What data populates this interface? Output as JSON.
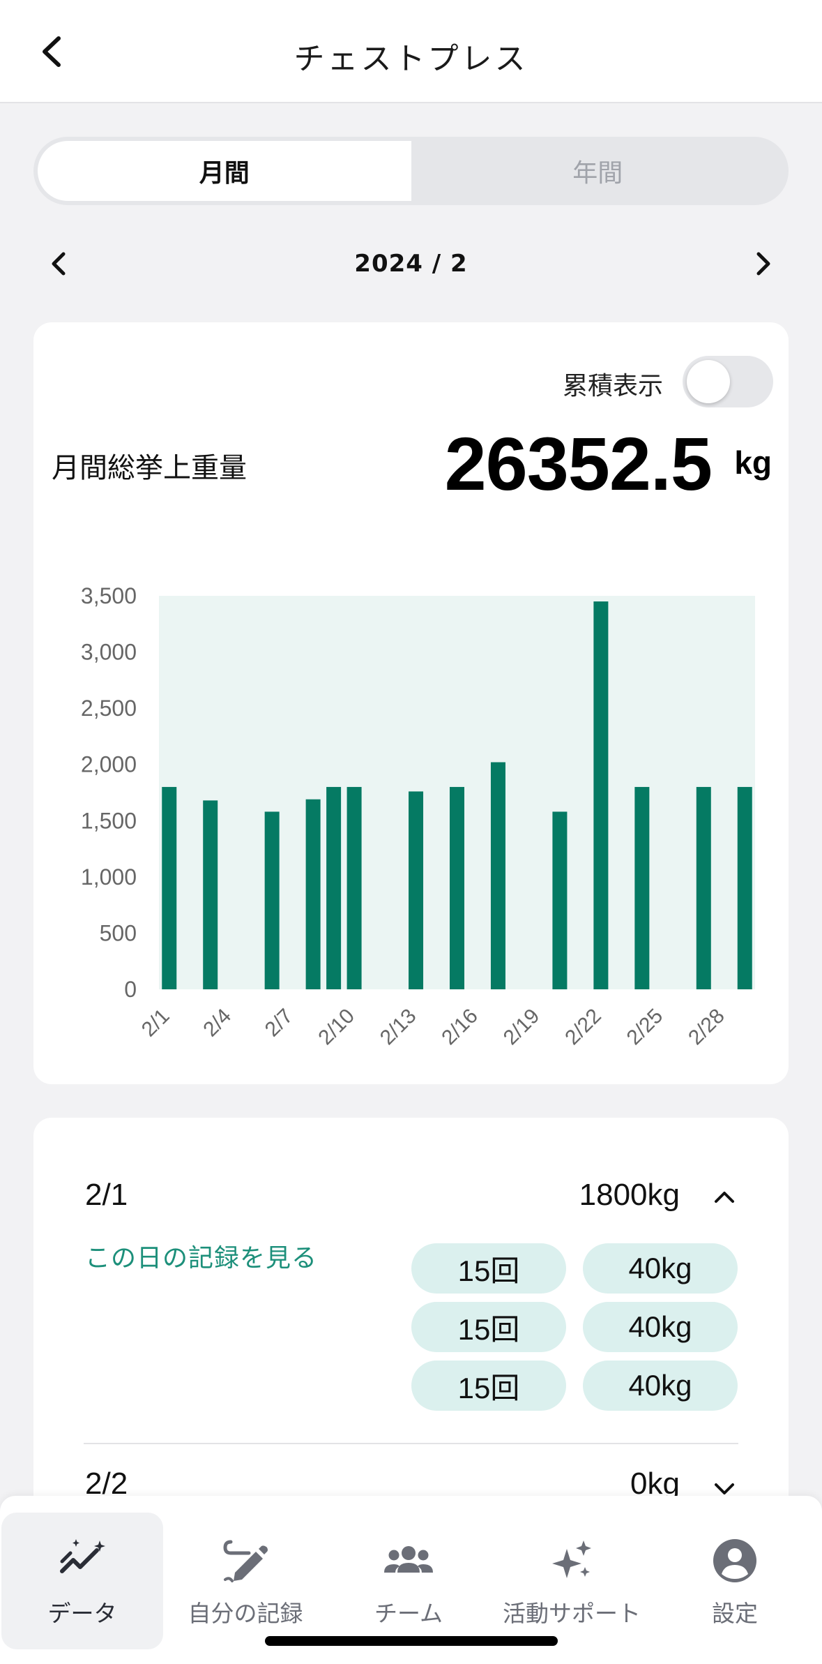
{
  "header": {
    "title": "チェストプレス"
  },
  "segment": {
    "monthly": "月間",
    "yearly": "年間"
  },
  "month_nav": {
    "label": "2024 / 2"
  },
  "summary": {
    "cumulative_label": "累積表示",
    "cumulative_on": false,
    "total_label": "月間総挙上重量",
    "total_value": "26352.5",
    "total_unit": "kg"
  },
  "chart_data": {
    "type": "bar",
    "x": [
      1,
      2,
      3,
      4,
      5,
      6,
      7,
      8,
      9,
      10,
      11,
      12,
      13,
      14,
      15,
      16,
      17,
      18,
      19,
      20,
      21,
      22,
      23,
      24,
      25,
      26,
      27,
      28,
      29
    ],
    "values": [
      1800,
      0,
      1680,
      0,
      0,
      1580,
      0,
      1690,
      1800,
      1800,
      0,
      0,
      1760,
      0,
      1800,
      0,
      2020,
      0,
      0,
      1580,
      0,
      3450,
      0,
      1800,
      0,
      0,
      1800,
      0,
      1800
    ],
    "tick_labels": [
      "2/1",
      "2/4",
      "2/7",
      "2/10",
      "2/13",
      "2/16",
      "2/19",
      "2/22",
      "2/25",
      "2/28"
    ],
    "tick_days": [
      1,
      4,
      7,
      10,
      13,
      16,
      19,
      22,
      25,
      28
    ],
    "y_ticks": [
      "3,500",
      "3,000",
      "2,500",
      "2,000",
      "1,500",
      "1,000",
      "500",
      "0"
    ],
    "y_tick_values": [
      3500,
      3000,
      2500,
      2000,
      1500,
      1000,
      500,
      0
    ],
    "ylim": [
      0,
      3500
    ],
    "bar_color": "#057a63",
    "plot_bg": "#ebf5f3",
    "grid": false,
    "legend": "none"
  },
  "records": {
    "first": {
      "date": "2/1",
      "total": "1800kg",
      "link": "この日の記録を見る",
      "sets": [
        {
          "reps": "15回",
          "weight": "40kg"
        },
        {
          "reps": "15回",
          "weight": "40kg"
        },
        {
          "reps": "15回",
          "weight": "40kg"
        }
      ]
    },
    "second": {
      "date": "2/2",
      "total": "0kg"
    }
  },
  "tabbar": {
    "items": [
      {
        "label": "データ",
        "icon": "chart-sparkle-icon"
      },
      {
        "label": "自分の記録",
        "icon": "pencil-note-icon"
      },
      {
        "label": "チーム",
        "icon": "group-icon"
      },
      {
        "label": "活動サポート",
        "icon": "sparkles-icon"
      },
      {
        "label": "設定",
        "icon": "account-icon"
      }
    ]
  }
}
